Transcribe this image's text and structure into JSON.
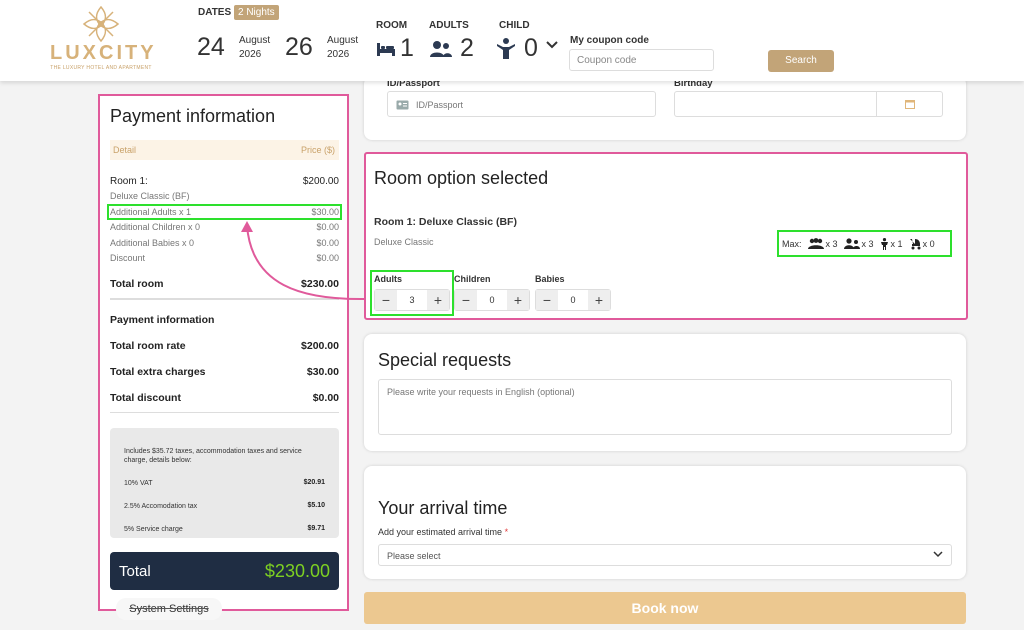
{
  "brand": {
    "name": "LUXCITY",
    "tagline": "THE LUXURY HOTEL AND APARTMENT",
    "accent": "#c2a478"
  },
  "header": {
    "dates_label": "DATES",
    "nights_badge": "2 Nights",
    "checkin": {
      "day": "24",
      "month": "August",
      "year": "2026"
    },
    "checkout": {
      "day": "26",
      "month": "August",
      "year": "2026"
    },
    "room_label": "ROOM",
    "room_value": "1",
    "adults_label": "ADULTS",
    "adults_value": "2",
    "child_label": "CHILD",
    "child_value": "0",
    "coupon_label": "My coupon code",
    "coupon_placeholder": "Coupon code",
    "search_label": "Search"
  },
  "payment": {
    "title": "Payment information",
    "col_detail": "Detail",
    "col_price": "Price ($)",
    "room1_label": "Room 1:",
    "room1_price": "$200.00",
    "room1_type": "Deluxe Classic (BF)",
    "rows": [
      {
        "label": "Additional Adults x 1",
        "value": "$30.00"
      },
      {
        "label": "Additional Children x 0",
        "value": "$0.00"
      },
      {
        "label": "Additional Babies x 0",
        "value": "$0.00"
      },
      {
        "label": "Discount",
        "value": "$0.00"
      }
    ],
    "total_room_label": "Total room",
    "total_room_value": "$230.00",
    "info_label": "Payment information",
    "summary": [
      {
        "label": "Total room rate",
        "value": "$200.00"
      },
      {
        "label": "Total extra charges",
        "value": "$30.00"
      },
      {
        "label": "Total discount",
        "value": "$0.00"
      }
    ],
    "tax_note": "Includes $35.72 taxes, accommodation taxes and service charge, details below:",
    "taxes": [
      {
        "label": "10% VAT",
        "value": "$20.91"
      },
      {
        "label": "2.5% Accomodation tax",
        "value": "$5.10"
      },
      {
        "label": "5% Service charge",
        "value": "$9.71"
      }
    ],
    "total_label": "Total",
    "total_value": "$230.00"
  },
  "system_settings": "System Settings",
  "guest": {
    "id_label": "ID/Passport",
    "id_placeholder": "ID/Passport",
    "birthday_label": "Birthday"
  },
  "room_option": {
    "title": "Room option selected",
    "room_name": "Room 1: Deluxe Classic (BF)",
    "room_sub": "Deluxe Classic",
    "max_label": "Max:",
    "max": [
      {
        "icon": "group-icon",
        "value": "x 3"
      },
      {
        "icon": "adults-icon",
        "value": "x 3"
      },
      {
        "icon": "child-icon",
        "value": "x 1"
      },
      {
        "icon": "stroller-icon",
        "value": "x 0"
      }
    ],
    "adults_label": "Adults",
    "adults_value": "3",
    "children_label": "Children",
    "children_value": "0",
    "babies_label": "Babies",
    "babies_value": "0"
  },
  "special": {
    "title": "Special requests",
    "placeholder": "Please write your requests in English (optional)"
  },
  "arrival": {
    "title": "Your arrival time",
    "sub": "Add your estimated arrival time",
    "required_mark": "*",
    "select_value": "Please select"
  },
  "book_label": "Book now"
}
